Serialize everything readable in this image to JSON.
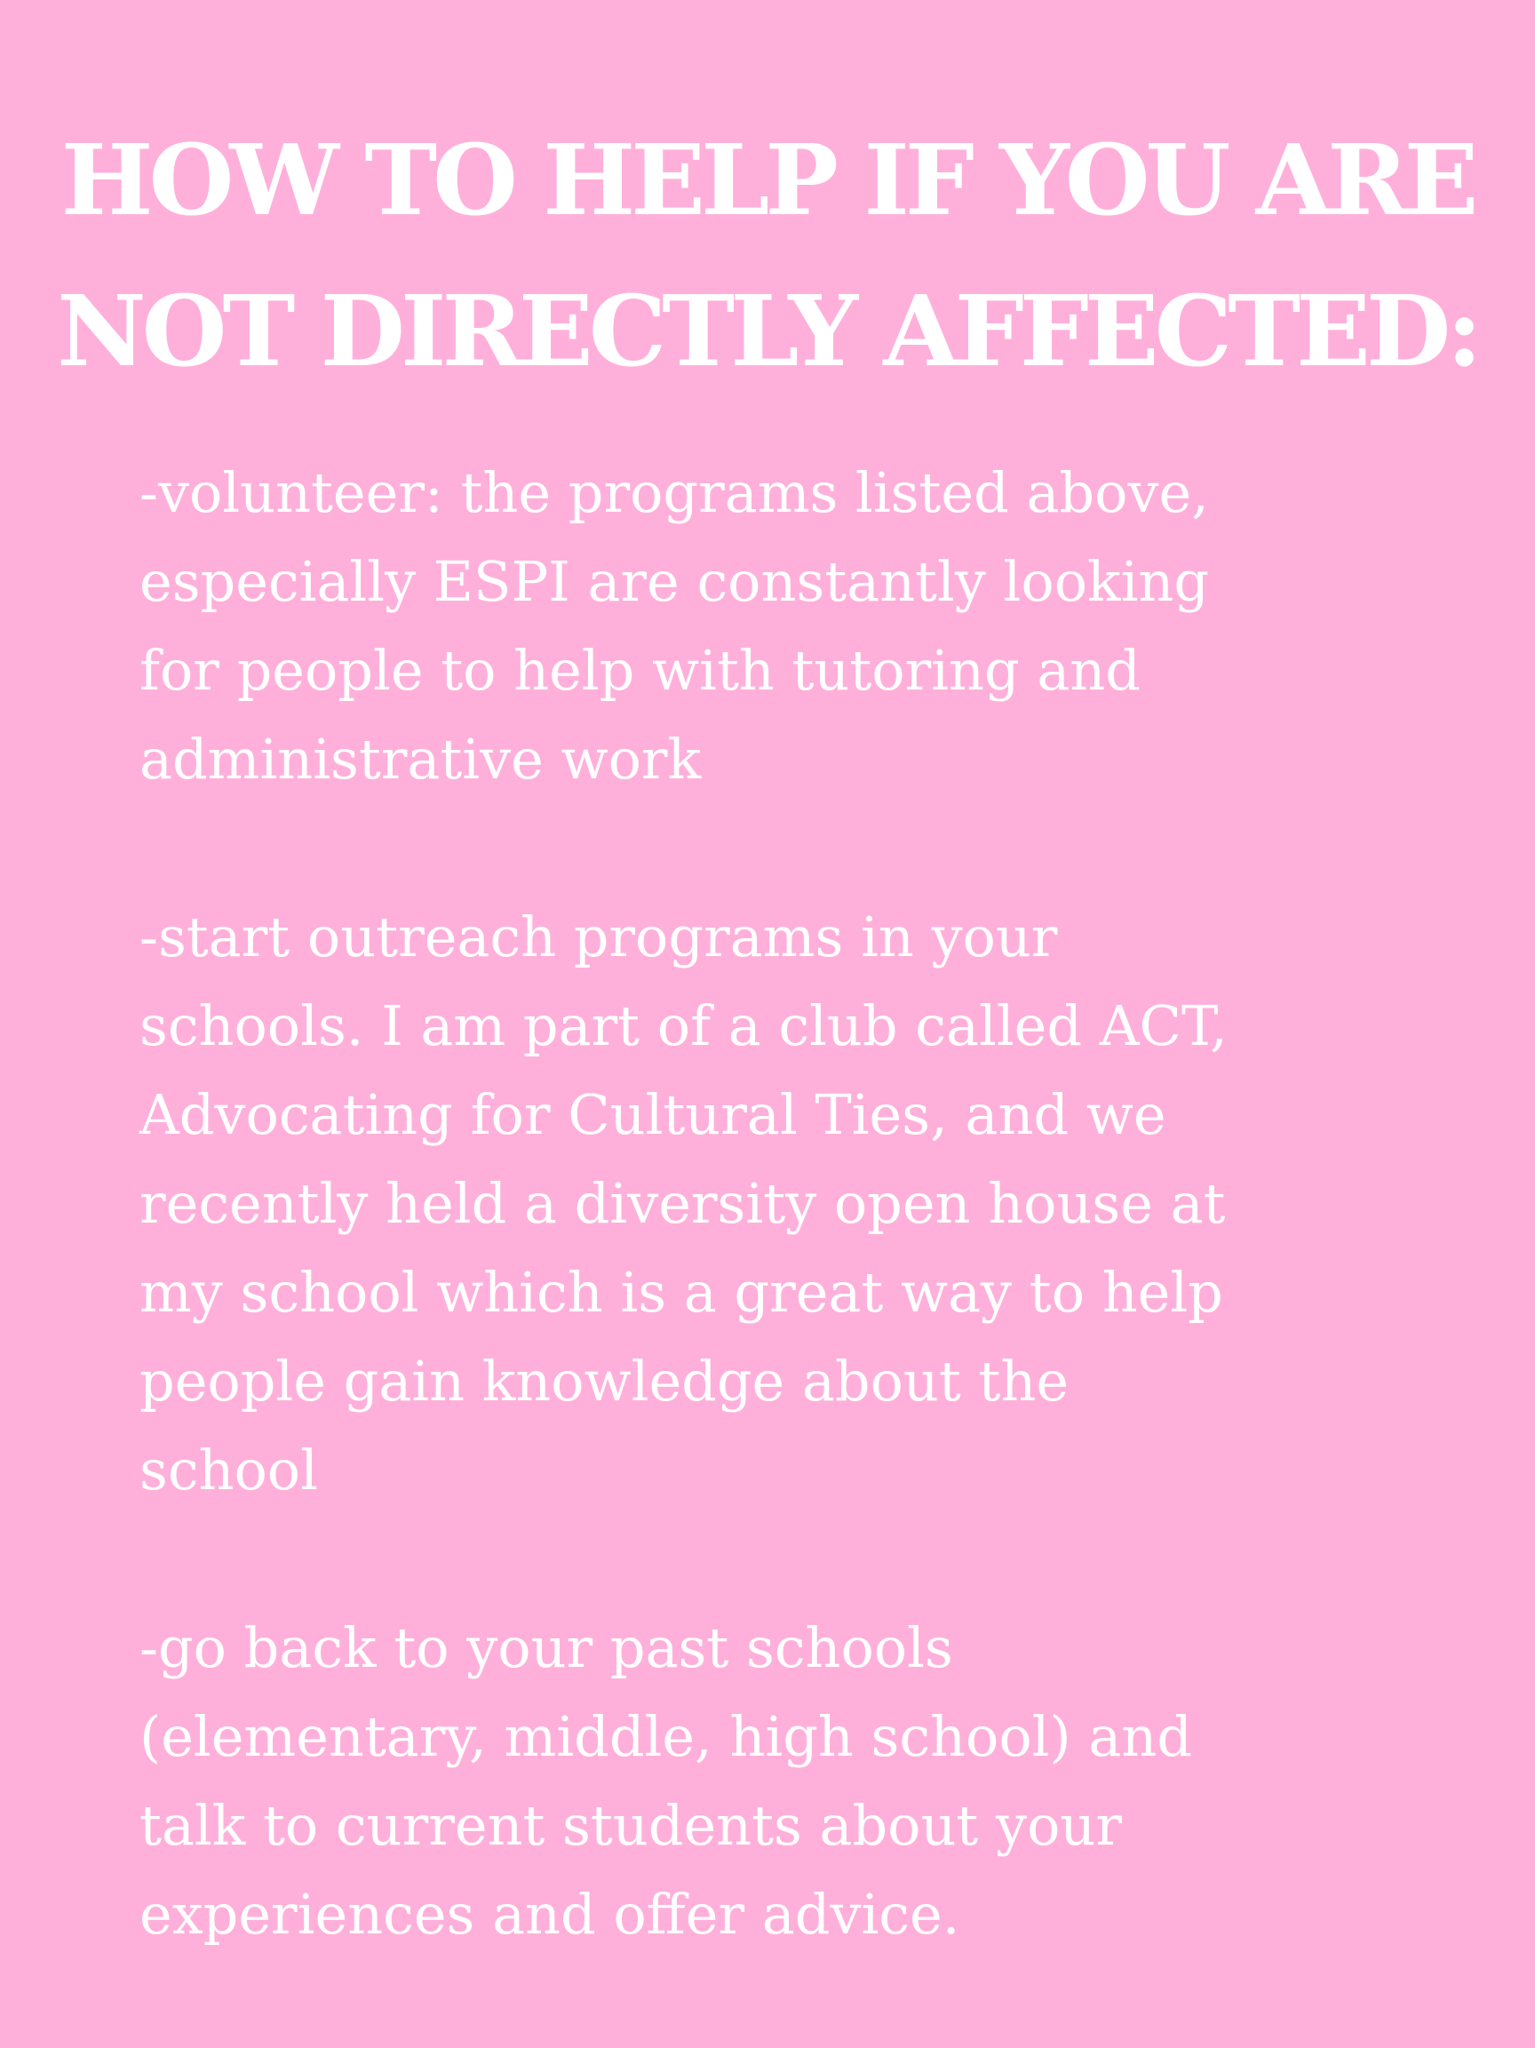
{
  "title": {
    "lines": [
      "HOW TO HELP IF YOU ARE",
      "NOT DIRECTLY AFFECTED:"
    ]
  },
  "paragraphs": [
    {
      "lines": [
        "-volunteer: the programs listed above,",
        "especially ESPI are constantly looking",
        "for people to help with tutoring and",
        "administrative work"
      ]
    },
    {
      "lines": [
        "-start outreach programs in your",
        "schools. I am part of a club called ACT,",
        "Advocating for Cultural Ties, and we",
        "recently held a diversity open house at",
        "my school which is a great way to help",
        "people gain knowledge about the",
        "school"
      ]
    },
    {
      "lines": [
        "-go back to your past schools",
        "(elementary, middle, high school) and",
        "talk to current students about your",
        "experiences and offer advice."
      ]
    }
  ],
  "colors": {
    "background": "#ffb0da",
    "text": "#ffffff"
  }
}
